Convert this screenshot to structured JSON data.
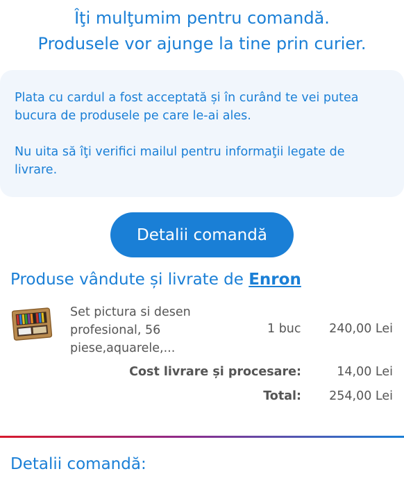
{
  "thanks": {
    "line1": "Îţi mulţumim pentru comandă.",
    "line2": "Produsele vor ajunge la tine prin curier."
  },
  "info": {
    "p1": "Plata cu cardul a fost acceptată și în curând te vei putea bucura de produsele pe care le-ai ales.",
    "p2": "Nu uita să îţi verifici mailul pentru informaţii legate de livrare."
  },
  "button": {
    "label": "Detalii comandă"
  },
  "seller": {
    "prefix": "Produse vândute și livrate de",
    "name": "Enron"
  },
  "product": {
    "name": "Set pictura si desen profesional, 56 piese,aquarele,...",
    "quantity": "1 buc",
    "price": "240,00 Lei",
    "image_icon": "art-set-case-icon"
  },
  "summary": {
    "shipping_label": "Cost livrare și procesare:",
    "shipping_value": "14,00 Lei",
    "total_label": "Total:",
    "total_value": "254,00 Lei"
  },
  "section": {
    "title": "Detalii comandă:"
  },
  "colors": {
    "accent": "#1a7fd6",
    "info_bg": "#f1f6fc",
    "text_gray": "#555555",
    "divider_start": "#d8192c"
  }
}
